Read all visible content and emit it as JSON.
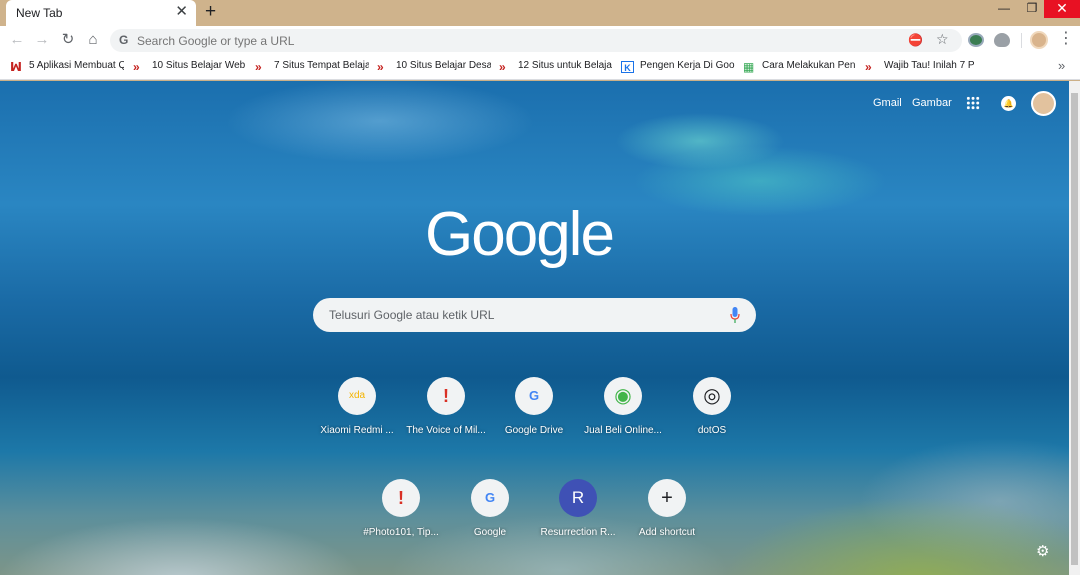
{
  "browser": {
    "tab_title": "New Tab",
    "tab_close": "✕",
    "new_tab": "+",
    "win_min": "—",
    "win_max": "❐",
    "win_close": "✕"
  },
  "toolbar": {
    "omnibox_placeholder": "Search Google or type a URL",
    "omnibox_icon": "google-g-icon",
    "back": "←",
    "forward": "→",
    "reload": "↻",
    "home": "⌂",
    "star": "☆",
    "menu": "⋮"
  },
  "bookmarks": [
    {
      "label": "5 Aplikasi Membuat Q",
      "icon": "red-chevron-icon",
      "glyph": "ꟽ"
    },
    {
      "label": "10 Situs Belajar Web",
      "icon": "red-chevron-icon",
      "glyph": "»"
    },
    {
      "label": "7 Situs Tempat Belaja",
      "icon": "red-chevron-icon",
      "glyph": "»"
    },
    {
      "label": "10 Situs Belajar Desa",
      "icon": "red-chevron-icon",
      "glyph": "»"
    },
    {
      "label": "12 Situs untuk Belaja",
      "icon": "red-chevron-icon",
      "glyph": "»"
    },
    {
      "label": "Pengen Kerja Di Goo",
      "icon": "k-icon",
      "glyph": "K"
    },
    {
      "label": "Cara Melakukan Pen",
      "icon": "sheets-icon",
      "glyph": "▦"
    },
    {
      "label": "Wajib Tau! Inilah 7 P",
      "icon": "red-chevron-icon",
      "glyph": "»"
    }
  ],
  "bookmarks_more": "»",
  "ntp": {
    "gmail": "Gmail",
    "images": "Gambar",
    "logo": "Google",
    "search_placeholder": "Telusuri Google atau ketik URL",
    "settings": "⚙"
  },
  "shortcuts": [
    {
      "label": "Xiaomi Redmi ...",
      "icon": "xda-icon",
      "glyph": "xda",
      "color": "#f4b400"
    },
    {
      "label": "The Voice of Mil...",
      "icon": "red-exclamation-icon",
      "glyph": "!",
      "color": "#d93025"
    },
    {
      "label": "Google Drive",
      "icon": "google-g-icon",
      "glyph": "G",
      "color": "#4285f4"
    },
    {
      "label": "Jual Beli Online...",
      "icon": "tokopedia-icon",
      "glyph": "◉",
      "color": "#42b549"
    },
    {
      "label": "dotOS",
      "icon": "dotos-icon",
      "glyph": "◎",
      "color": "#202124"
    },
    {
      "label": "#Photo101, Tip...",
      "icon": "red-exclamation-icon",
      "glyph": "!",
      "color": "#d93025"
    },
    {
      "label": "Google",
      "icon": "google-g-icon",
      "glyph": "G",
      "color": "#4285f4"
    },
    {
      "label": "Resurrection R...",
      "icon": "r-letter-icon",
      "glyph": "R",
      "color": "#ffffff"
    },
    {
      "label": "Add shortcut",
      "icon": "plus-icon",
      "glyph": "+",
      "color": "#202124"
    }
  ],
  "colors": {
    "titlebar": "#cfb38c",
    "close_button": "#e81123",
    "resurrection_tile": "#3f51b5"
  }
}
